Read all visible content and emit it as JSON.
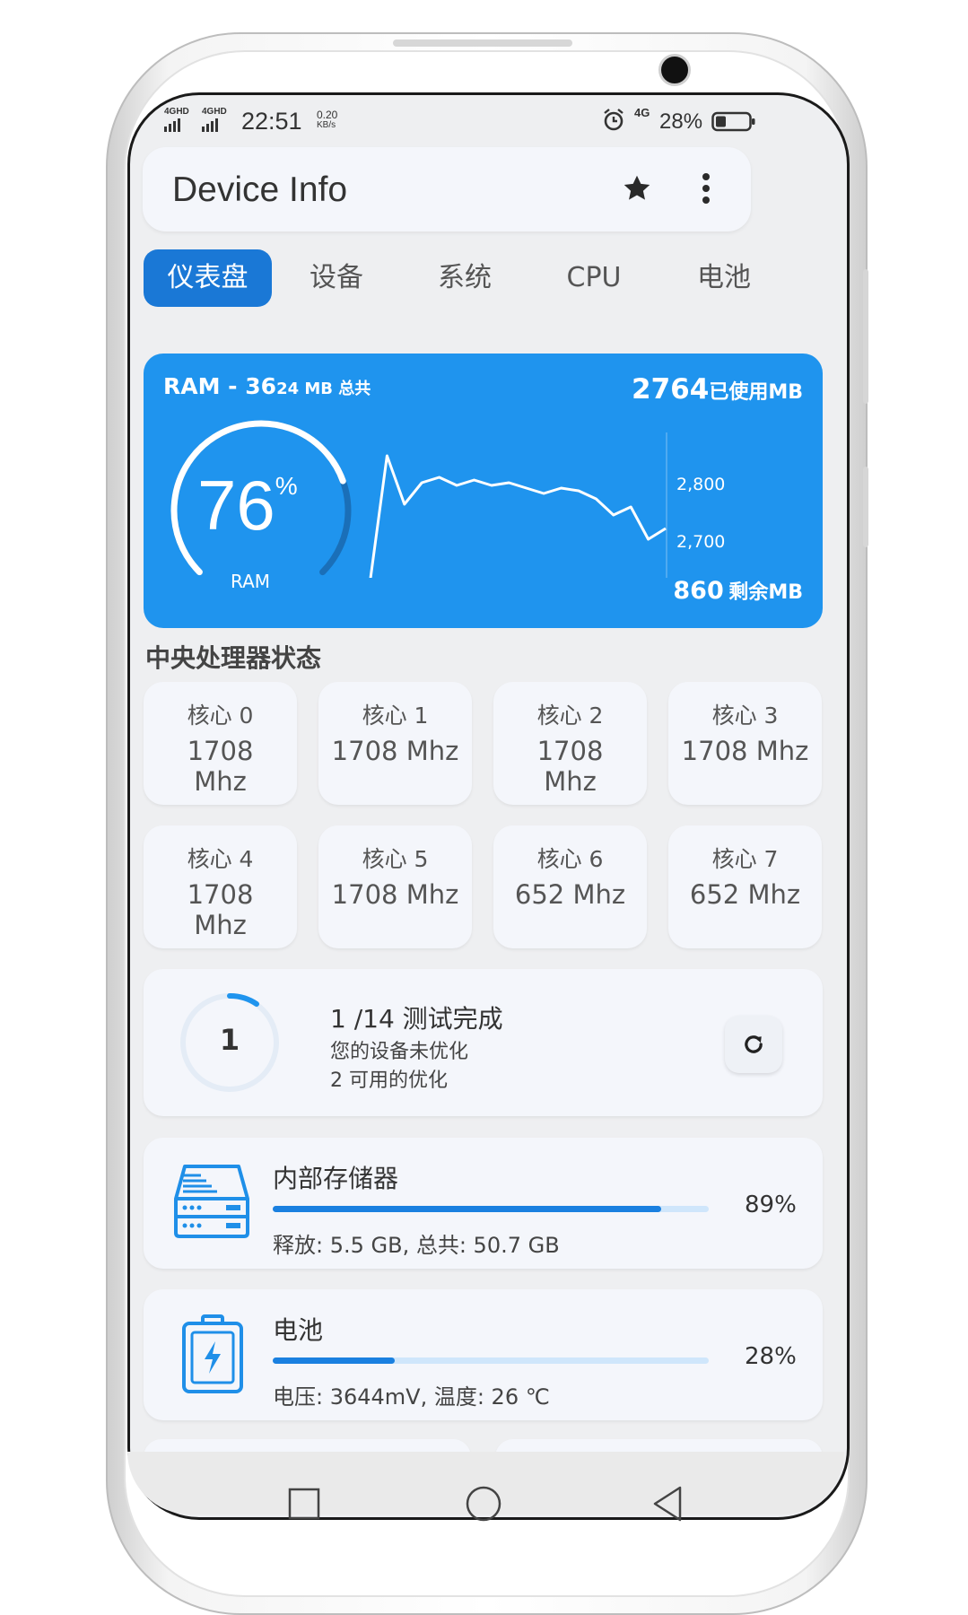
{
  "status_bar": {
    "sim1": "4GHD",
    "sim2": "4GHD",
    "time": "22:51",
    "speed_value": "0.20",
    "speed_unit": "KB/s",
    "net": "4G",
    "battery": "28%"
  },
  "app_bar": {
    "title": "Device Info",
    "star_icon": "star-icon",
    "more_icon": "more-vert-icon"
  },
  "tabs": [
    {
      "label": "仪表盘",
      "active": true
    },
    {
      "label": "设备",
      "active": false
    },
    {
      "label": "系统",
      "active": false
    },
    {
      "label": "CPU",
      "active": false
    },
    {
      "label": "电池",
      "active": false
    }
  ],
  "ram": {
    "title_prefix": "RAM - 36",
    "title_suffix": "24 MB 总共",
    "used_value": "2764",
    "used_label": "已使用MB",
    "percent": "76",
    "percent_sign": "%",
    "gauge_fraction": 0.76,
    "gauge_label": "RAM",
    "free_value": "860",
    "free_label": "剩余MB",
    "chart": {
      "type": "line",
      "y_ticks": [
        "2,800",
        "2,700"
      ],
      "values": [
        2630,
        2870,
        2780,
        2820,
        2830,
        2815,
        2825,
        2815,
        2820,
        2810,
        2800,
        2810,
        2805,
        2790,
        2760,
        2775,
        2715,
        2735
      ]
    },
    "accent": "#1f94ee"
  },
  "cpu": {
    "section_title": "中央处理器状态",
    "cores": [
      {
        "label": "核心 0",
        "value": "1708 Mhz"
      },
      {
        "label": "核心 1",
        "value": "1708 Mhz"
      },
      {
        "label": "核心 2",
        "value": "1708 Mhz"
      },
      {
        "label": "核心 3",
        "value": "1708 Mhz"
      },
      {
        "label": "核心 4",
        "value": "1708 Mhz"
      },
      {
        "label": "核心 5",
        "value": "1708 Mhz"
      },
      {
        "label": "核心 6",
        "value": "652 Mhz"
      },
      {
        "label": "核心 7",
        "value": "652 Mhz"
      }
    ]
  },
  "tests": {
    "count": "1",
    "title": "1 /14 测试完成",
    "line1": "您的设备未优化",
    "line2": "2 可用的优化",
    "refresh_icon": "refresh-icon"
  },
  "storage": {
    "title": "内部存储器",
    "percent": "89%",
    "fill": 0.89,
    "detail": "释放: 5.5 GB,  总共: 50.7 GB",
    "icon": "hard-drive-icon"
  },
  "battery": {
    "title": "电池",
    "percent": "28%",
    "fill": 0.28,
    "detail": "电压: 3644mV,  温度: 26 ℃",
    "icon": "battery-charging-icon"
  },
  "nav": {
    "recent": "square-icon",
    "home": "circle-icon",
    "back": "triangle-back-icon"
  }
}
